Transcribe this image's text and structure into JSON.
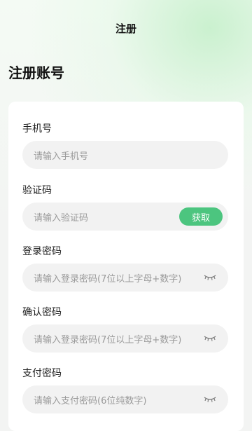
{
  "header": {
    "title": "注册"
  },
  "page": {
    "heading": "注册账号"
  },
  "form": {
    "phone": {
      "label": "手机号",
      "placeholder": "请输入手机号"
    },
    "code": {
      "label": "验证码",
      "placeholder": "请输入验证码",
      "button": "获取"
    },
    "login_password": {
      "label": "登录密码",
      "placeholder": "请输入登录密码(7位以上字母+数字)"
    },
    "confirm_password": {
      "label": "确认密码",
      "placeholder": "请输入登录密码(7位以上字母+数字)"
    },
    "pay_password": {
      "label": "支付密码",
      "placeholder": "请输入支付密码(6位纯数字)"
    }
  },
  "colors": {
    "accent": "#4cc57f",
    "input_bg": "#f2f2f2",
    "placeholder": "#9a9a9a"
  },
  "icons": {
    "password_toggle": "eye-closed-icon"
  }
}
